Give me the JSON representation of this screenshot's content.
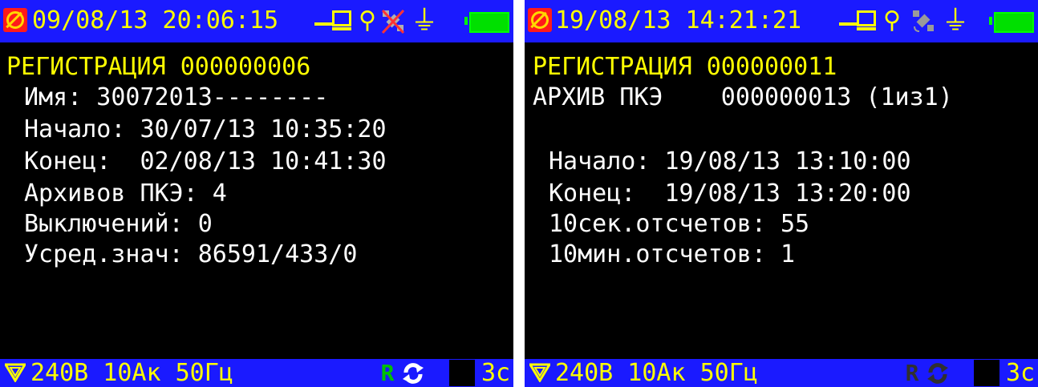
{
  "colors": {
    "bar_background": "#1a1aff",
    "screen_background": "#000000",
    "accent_yellow": "#ffff00",
    "text_white": "#ffffff",
    "logo_red": "#ff1a1a",
    "battery_green": "#00e000",
    "usb_inactive_red": "#ff3333",
    "green_icon": "#00c000",
    "gray_icon": "#9a9a9a",
    "dark_icon": "#303030"
  },
  "icons": {
    "logo": "brand-logo-icon",
    "pc": "pc-connection-icon",
    "usb": "usb-icon",
    "gps": "gps-satellite-icon",
    "power": "plug-icon",
    "battery": "battery-full-icon",
    "phase": "triangle-phase-icon",
    "r": "r-mode-icon",
    "sync": "sync-icon"
  },
  "left_screen": {
    "header": {
      "datetime": "09/08/13 20:06:15"
    },
    "gps_state": "disabled",
    "content": {
      "title": "РЕГИСТРАЦИЯ 000000006",
      "lines": [
        "Имя: 30072013--------",
        "Начало: 30/07/13 10:35:20",
        "Конец:  02/08/13 10:41:30",
        "Архивов ПКЭ: 4",
        "Выключений: 0",
        "Усред.знач: 86591/433/0"
      ]
    },
    "footer": {
      "values": "240В 10Ак 50Гц",
      "r_state": "green",
      "timeout": "3с"
    }
  },
  "right_screen": {
    "header": {
      "datetime": "19/08/13 14:21:21"
    },
    "gps_state": "searching",
    "content": {
      "title": "РЕГИСТРАЦИЯ 000000011",
      "archive_line": "АРХИВ ПКЭ    000000013 (1из1)",
      "lines": [
        "Начало: 19/08/13 13:10:00",
        "Конец:  19/08/13 13:20:00",
        "10сек.отсчетов: 55",
        "10мин.отсчетов: 1"
      ]
    },
    "footer": {
      "values": "240В 10Ак 50Гц",
      "r_state": "dark",
      "timeout": "3с"
    }
  }
}
